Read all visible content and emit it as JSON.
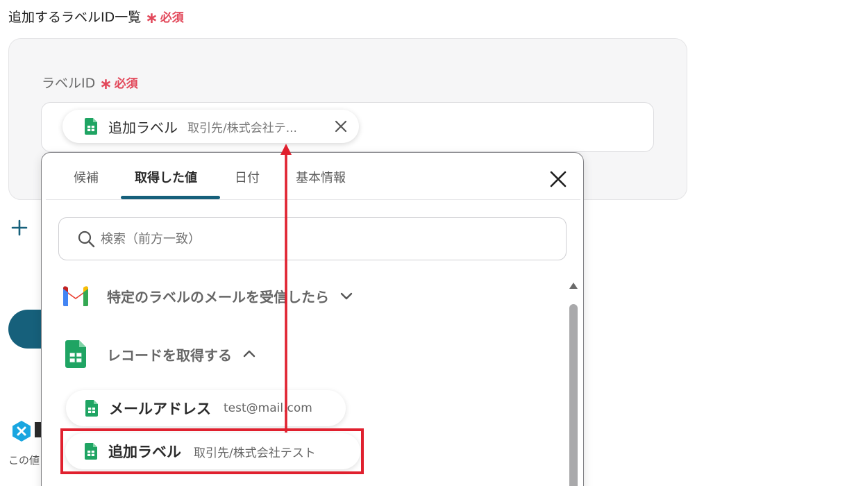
{
  "section": {
    "title": "追加するラベルID一覧",
    "required": "必須"
  },
  "field": {
    "label": "ラベルID",
    "required": "必須",
    "chip": {
      "name": "追加ラベル",
      "value": "取引先/株式会社テ..."
    }
  },
  "panel": {
    "tabs": [
      "候補",
      "取得した値",
      "日付",
      "基本情報"
    ],
    "active_tab": "取得した値",
    "search_placeholder": "検索（前方一致）",
    "groups": [
      {
        "title": "特定のラベルのメールを受信したら",
        "icon": "gmail-icon",
        "expanded": false
      },
      {
        "title": "レコードを取得する",
        "icon": "google-sheets-icon",
        "expanded": true
      }
    ],
    "items": [
      {
        "name": "メールアドレス",
        "value": "test@mail.com",
        "icon": "google-sheets-icon"
      },
      {
        "name": "追加ラベル",
        "value": "取引先/株式会社テスト",
        "icon": "google-sheets-icon"
      }
    ]
  },
  "sidebar": {
    "text": "この値"
  },
  "colors": {
    "accent": "#16607b",
    "required": "#e2485a",
    "highlight": "#e0202e",
    "sheets_green": "#1fa463"
  }
}
